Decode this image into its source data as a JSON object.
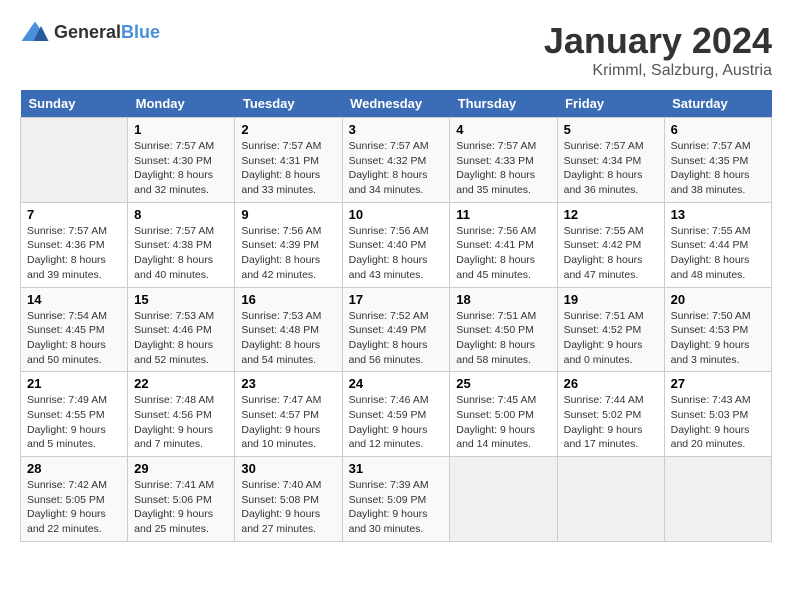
{
  "header": {
    "logo_general": "General",
    "logo_blue": "Blue",
    "title": "January 2024",
    "subtitle": "Krimml, Salzburg, Austria"
  },
  "calendar": {
    "days_of_week": [
      "Sunday",
      "Monday",
      "Tuesday",
      "Wednesday",
      "Thursday",
      "Friday",
      "Saturday"
    ],
    "weeks": [
      [
        {
          "day": "",
          "empty": true
        },
        {
          "day": "1",
          "sunrise": "Sunrise: 7:57 AM",
          "sunset": "Sunset: 4:30 PM",
          "daylight": "Daylight: 8 hours and 32 minutes."
        },
        {
          "day": "2",
          "sunrise": "Sunrise: 7:57 AM",
          "sunset": "Sunset: 4:31 PM",
          "daylight": "Daylight: 8 hours and 33 minutes."
        },
        {
          "day": "3",
          "sunrise": "Sunrise: 7:57 AM",
          "sunset": "Sunset: 4:32 PM",
          "daylight": "Daylight: 8 hours and 34 minutes."
        },
        {
          "day": "4",
          "sunrise": "Sunrise: 7:57 AM",
          "sunset": "Sunset: 4:33 PM",
          "daylight": "Daylight: 8 hours and 35 minutes."
        },
        {
          "day": "5",
          "sunrise": "Sunrise: 7:57 AM",
          "sunset": "Sunset: 4:34 PM",
          "daylight": "Daylight: 8 hours and 36 minutes."
        },
        {
          "day": "6",
          "sunrise": "Sunrise: 7:57 AM",
          "sunset": "Sunset: 4:35 PM",
          "daylight": "Daylight: 8 hours and 38 minutes."
        }
      ],
      [
        {
          "day": "7",
          "sunrise": "Sunrise: 7:57 AM",
          "sunset": "Sunset: 4:36 PM",
          "daylight": "Daylight: 8 hours and 39 minutes."
        },
        {
          "day": "8",
          "sunrise": "Sunrise: 7:57 AM",
          "sunset": "Sunset: 4:38 PM",
          "daylight": "Daylight: 8 hours and 40 minutes."
        },
        {
          "day": "9",
          "sunrise": "Sunrise: 7:56 AM",
          "sunset": "Sunset: 4:39 PM",
          "daylight": "Daylight: 8 hours and 42 minutes."
        },
        {
          "day": "10",
          "sunrise": "Sunrise: 7:56 AM",
          "sunset": "Sunset: 4:40 PM",
          "daylight": "Daylight: 8 hours and 43 minutes."
        },
        {
          "day": "11",
          "sunrise": "Sunrise: 7:56 AM",
          "sunset": "Sunset: 4:41 PM",
          "daylight": "Daylight: 8 hours and 45 minutes."
        },
        {
          "day": "12",
          "sunrise": "Sunrise: 7:55 AM",
          "sunset": "Sunset: 4:42 PM",
          "daylight": "Daylight: 8 hours and 47 minutes."
        },
        {
          "day": "13",
          "sunrise": "Sunrise: 7:55 AM",
          "sunset": "Sunset: 4:44 PM",
          "daylight": "Daylight: 8 hours and 48 minutes."
        }
      ],
      [
        {
          "day": "14",
          "sunrise": "Sunrise: 7:54 AM",
          "sunset": "Sunset: 4:45 PM",
          "daylight": "Daylight: 8 hours and 50 minutes."
        },
        {
          "day": "15",
          "sunrise": "Sunrise: 7:53 AM",
          "sunset": "Sunset: 4:46 PM",
          "daylight": "Daylight: 8 hours and 52 minutes."
        },
        {
          "day": "16",
          "sunrise": "Sunrise: 7:53 AM",
          "sunset": "Sunset: 4:48 PM",
          "daylight": "Daylight: 8 hours and 54 minutes."
        },
        {
          "day": "17",
          "sunrise": "Sunrise: 7:52 AM",
          "sunset": "Sunset: 4:49 PM",
          "daylight": "Daylight: 8 hours and 56 minutes."
        },
        {
          "day": "18",
          "sunrise": "Sunrise: 7:51 AM",
          "sunset": "Sunset: 4:50 PM",
          "daylight": "Daylight: 8 hours and 58 minutes."
        },
        {
          "day": "19",
          "sunrise": "Sunrise: 7:51 AM",
          "sunset": "Sunset: 4:52 PM",
          "daylight": "Daylight: 9 hours and 0 minutes."
        },
        {
          "day": "20",
          "sunrise": "Sunrise: 7:50 AM",
          "sunset": "Sunset: 4:53 PM",
          "daylight": "Daylight: 9 hours and 3 minutes."
        }
      ],
      [
        {
          "day": "21",
          "sunrise": "Sunrise: 7:49 AM",
          "sunset": "Sunset: 4:55 PM",
          "daylight": "Daylight: 9 hours and 5 minutes."
        },
        {
          "day": "22",
          "sunrise": "Sunrise: 7:48 AM",
          "sunset": "Sunset: 4:56 PM",
          "daylight": "Daylight: 9 hours and 7 minutes."
        },
        {
          "day": "23",
          "sunrise": "Sunrise: 7:47 AM",
          "sunset": "Sunset: 4:57 PM",
          "daylight": "Daylight: 9 hours and 10 minutes."
        },
        {
          "day": "24",
          "sunrise": "Sunrise: 7:46 AM",
          "sunset": "Sunset: 4:59 PM",
          "daylight": "Daylight: 9 hours and 12 minutes."
        },
        {
          "day": "25",
          "sunrise": "Sunrise: 7:45 AM",
          "sunset": "Sunset: 5:00 PM",
          "daylight": "Daylight: 9 hours and 14 minutes."
        },
        {
          "day": "26",
          "sunrise": "Sunrise: 7:44 AM",
          "sunset": "Sunset: 5:02 PM",
          "daylight": "Daylight: 9 hours and 17 minutes."
        },
        {
          "day": "27",
          "sunrise": "Sunrise: 7:43 AM",
          "sunset": "Sunset: 5:03 PM",
          "daylight": "Daylight: 9 hours and 20 minutes."
        }
      ],
      [
        {
          "day": "28",
          "sunrise": "Sunrise: 7:42 AM",
          "sunset": "Sunset: 5:05 PM",
          "daylight": "Daylight: 9 hours and 22 minutes."
        },
        {
          "day": "29",
          "sunrise": "Sunrise: 7:41 AM",
          "sunset": "Sunset: 5:06 PM",
          "daylight": "Daylight: 9 hours and 25 minutes."
        },
        {
          "day": "30",
          "sunrise": "Sunrise: 7:40 AM",
          "sunset": "Sunset: 5:08 PM",
          "daylight": "Daylight: 9 hours and 27 minutes."
        },
        {
          "day": "31",
          "sunrise": "Sunrise: 7:39 AM",
          "sunset": "Sunset: 5:09 PM",
          "daylight": "Daylight: 9 hours and 30 minutes."
        },
        {
          "day": "",
          "empty": true
        },
        {
          "day": "",
          "empty": true
        },
        {
          "day": "",
          "empty": true
        }
      ]
    ]
  }
}
